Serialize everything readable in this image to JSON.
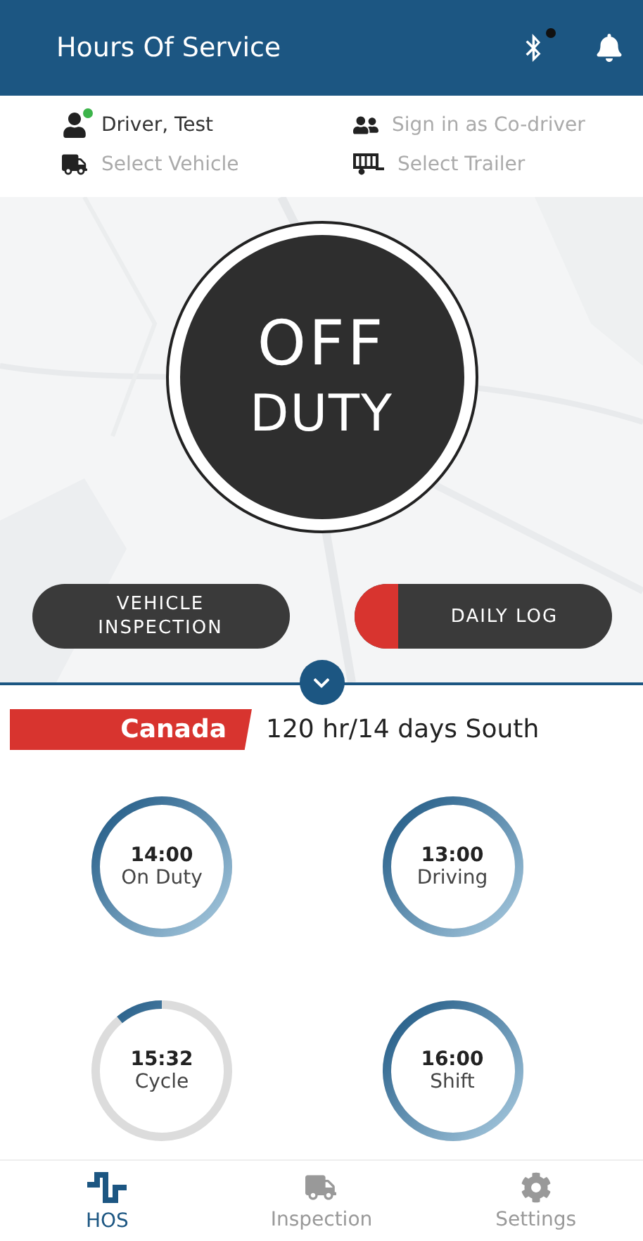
{
  "header": {
    "title": "Hours Of Service",
    "bluetooth_alert": true
  },
  "people": [
    {
      "kind": "driver",
      "label": "Driver, Test",
      "active": true,
      "online": true
    },
    {
      "kind": "codriver",
      "label": "Sign in as Co-driver",
      "active": false,
      "online": false
    },
    {
      "kind": "vehicle",
      "label": "Select Vehicle",
      "active": false,
      "online": false
    },
    {
      "kind": "trailer",
      "label": "Select Trailer",
      "active": false,
      "online": false
    }
  ],
  "status": {
    "line1": "OFF",
    "line2": "DUTY"
  },
  "actions": [
    {
      "label": "VEHICLE INSPECTION",
      "alert": false
    },
    {
      "label": "DAILY LOG",
      "alert": true
    }
  ],
  "ruleset": {
    "country": "Canada",
    "cycle": "120 hr/14 days South"
  },
  "clocks": [
    {
      "time": "14:00",
      "label": "On Duty",
      "level": 1
    },
    {
      "time": "13:00",
      "label": "Driving",
      "level": 1
    },
    {
      "time": "15:32",
      "label": "Cycle",
      "level": 0.11
    },
    {
      "time": "16:00",
      "label": "Shift",
      "level": 1
    }
  ],
  "nav": [
    {
      "kind": "hos",
      "label": "HOS",
      "selected": true
    },
    {
      "kind": "truck",
      "label": "Inspection",
      "selected": false
    },
    {
      "kind": "gear",
      "label": "Settings",
      "selected": false
    }
  ]
}
